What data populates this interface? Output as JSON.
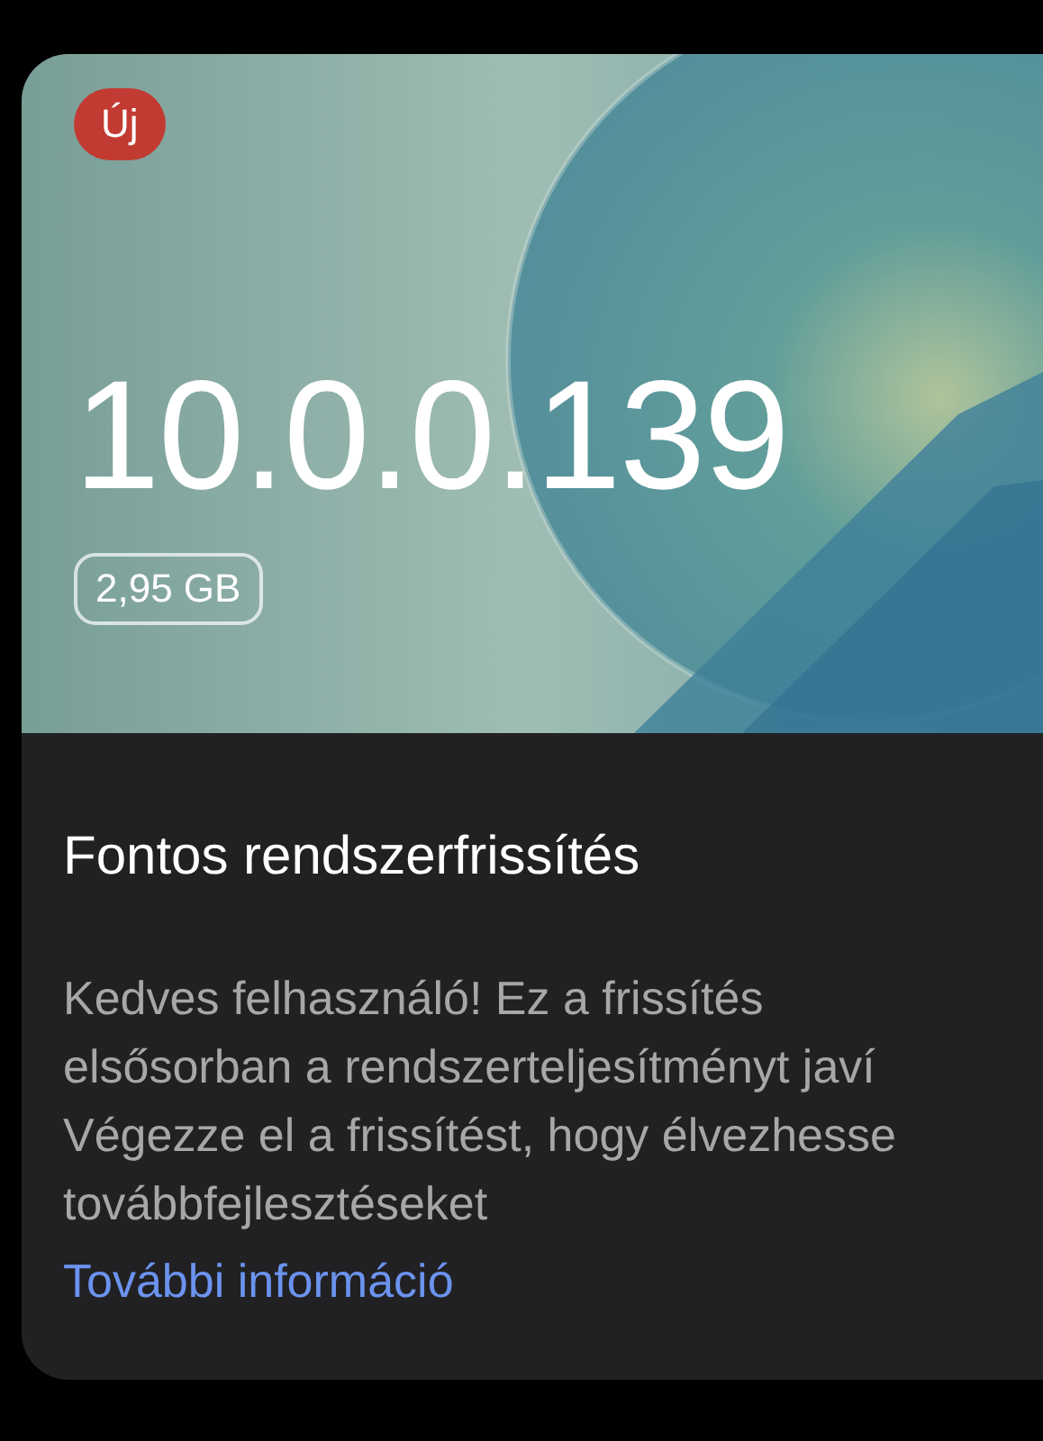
{
  "update_card": {
    "badge": "Új",
    "version": "10.0.0.139",
    "size": "2,95 GB",
    "title": "Fontos rendszerfrissítés",
    "description_lines": [
      "Kedves felhasználó! Ez a frissítés",
      "elsősorban a rendszerteljesítményt javí",
      "Végezze el a frissítést, hogy élvezhesse",
      "továbbfejlesztéseket"
    ],
    "link": "További információ"
  }
}
